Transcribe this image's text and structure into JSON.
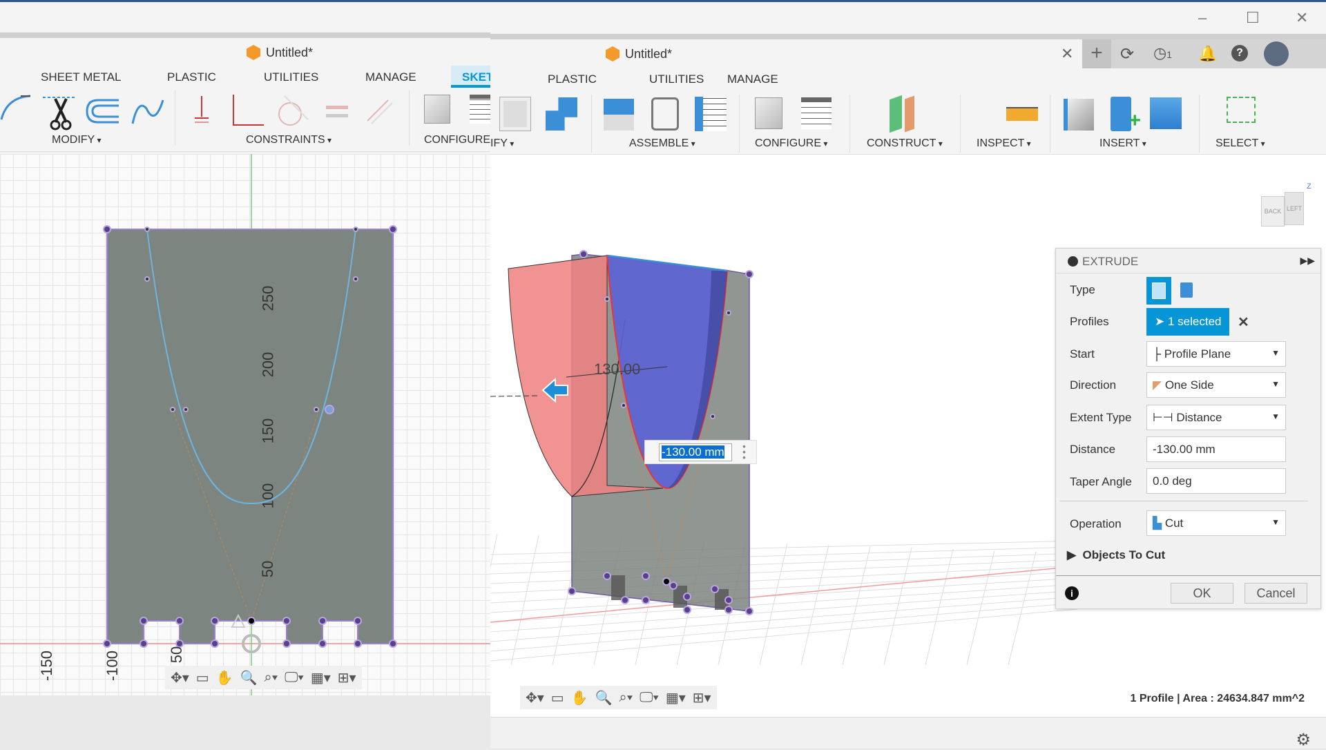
{
  "left_window": {
    "title": "Untitled*",
    "tabs": [
      "SHEET METAL",
      "PLASTIC",
      "UTILITIES",
      "MANAGE",
      "SKET"
    ],
    "active_tab": "SKET",
    "toolbar_groups": [
      "MODIFY",
      "CONSTRAINTS",
      "CONFIGURE"
    ],
    "sketch_axis_labels_vertical": [
      "250",
      "200",
      "150",
      "100",
      "50"
    ],
    "sketch_axis_labels_horizontal": [
      "-150",
      "-100",
      "50"
    ]
  },
  "right_window": {
    "title": "Untitled*",
    "tabs": [
      "PLASTIC",
      "UTILITIES",
      "MANAGE"
    ],
    "toolbar_groups": [
      "IFY",
      "ASSEMBLE",
      "CONFIGURE",
      "CONSTRUCT",
      "INSPECT",
      "INSERT",
      "SELECT"
    ],
    "job_count": "1",
    "viewcube": {
      "back": "BACK",
      "left": "LEFT",
      "axis": "Z"
    },
    "dimension_label": "130.00",
    "distance_input": "-130.00 mm",
    "status": "1 Profile | Area : 24634.847 mm^2"
  },
  "extrude": {
    "title": "EXTRUDE",
    "rows": {
      "type": "Type",
      "profiles": "Profiles",
      "profiles_value": "1 selected",
      "start": "Start",
      "start_value": "Profile Plane",
      "direction": "Direction",
      "direction_value": "One Side",
      "extent_type": "Extent Type",
      "extent_value": "Distance",
      "distance": "Distance",
      "distance_value": "-130.00 mm",
      "taper": "Taper Angle",
      "taper_value": "0.0 deg",
      "operation": "Operation",
      "operation_value": "Cut",
      "objects_to_cut": "Objects To Cut"
    },
    "ok": "OK",
    "cancel": "Cancel"
  },
  "colors": {
    "accent": "#0696d7",
    "cut_red": "#f08080",
    "profile_blue": "#5b63d6",
    "body_gray": "#7d8580"
  }
}
